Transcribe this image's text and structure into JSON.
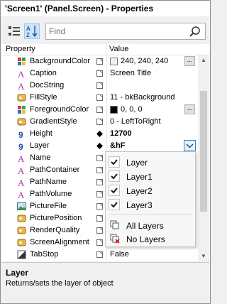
{
  "window": {
    "title": "'Screen1' (Panel.Screen) - Properties"
  },
  "toolbar": {
    "search_placeholder": "Find",
    "buttons": [
      {
        "icon": "categorized-icon",
        "active": false
      },
      {
        "icon": "sort-az-icon",
        "active": true
      }
    ],
    "az_label": "AZ"
  },
  "grid": {
    "header": {
      "property": "Property",
      "value": "Value"
    },
    "rows": [
      {
        "icon": "color-type-icon",
        "name": "BackgroundColor",
        "value": "240, 240, 240",
        "swatch": "#f0f0f0",
        "ellipsis": "..."
      },
      {
        "icon": "text-type-icon",
        "name": "Caption",
        "value": "Screen Title"
      },
      {
        "icon": "text-type-icon",
        "name": "DocString",
        "value": ""
      },
      {
        "icon": "enum-type-icon",
        "name": "FillStyle",
        "value": "11 - bkBackground"
      },
      {
        "icon": "color-type-icon",
        "name": "ForegroundColor",
        "value": "0, 0, 0",
        "swatch": "#000000",
        "ellipsis": "..."
      },
      {
        "icon": "enum-type-icon",
        "name": "GradientStyle",
        "value": "0 - LeftToRight"
      },
      {
        "icon": "number-type-icon",
        "name": "Height",
        "value": "12700",
        "bold": true
      },
      {
        "icon": "number-type-icon",
        "name": "Layer",
        "value": "&hF",
        "bold": true,
        "selected": true,
        "dropdown": true
      },
      {
        "icon": "text-type-icon",
        "name": "Name",
        "value": ""
      },
      {
        "icon": "text-type-icon",
        "name": "PathContainer",
        "value": ""
      },
      {
        "icon": "text-type-icon",
        "name": "PathName",
        "value": ""
      },
      {
        "icon": "text-type-icon",
        "name": "PathVolume",
        "value": ""
      },
      {
        "icon": "picture-type-icon",
        "name": "PictureFile",
        "value": ""
      },
      {
        "icon": "enum-type-icon",
        "name": "PicturePosition",
        "value": ""
      },
      {
        "icon": "enum-type-icon",
        "name": "RenderQuality",
        "value": ""
      },
      {
        "icon": "enum-type-icon",
        "name": "ScreenAlignment",
        "value": ""
      },
      {
        "icon": "bool-type-icon",
        "name": "TabStop",
        "value": "False"
      }
    ]
  },
  "layer_dropdown": {
    "items": [
      {
        "label": "Layer",
        "checked": true
      },
      {
        "label": "Layer1",
        "checked": true
      },
      {
        "label": "Layer2",
        "checked": true
      },
      {
        "label": "Layer3",
        "checked": true
      }
    ],
    "all_layers": "All Layers",
    "no_layers": "No Layers"
  },
  "description": {
    "title": "Layer",
    "text": "Returns/sets the layer of object"
  }
}
